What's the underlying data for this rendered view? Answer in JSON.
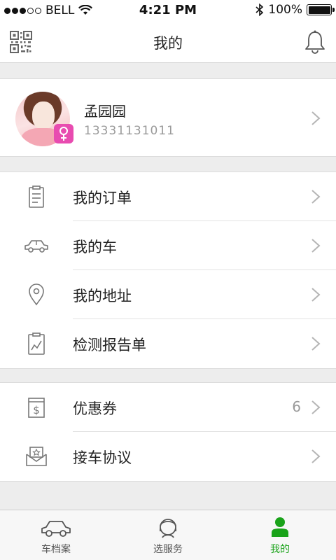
{
  "status_bar": {
    "carrier": "BELL",
    "time": "4:21 PM",
    "battery": "100%"
  },
  "header": {
    "title": "我的",
    "left_icon": "qr-code-icon",
    "right_icon": "bell-icon"
  },
  "profile": {
    "name": "孟园园",
    "phone": "13331131011",
    "gender_icon": "female-icon",
    "badge_color": "#e84bb0"
  },
  "menu_group_1": [
    {
      "label": "我的订单",
      "icon": "clipboard-icon"
    },
    {
      "label": "我的车",
      "icon": "car-icon"
    },
    {
      "label": "我的地址",
      "icon": "location-pin-icon"
    },
    {
      "label": "检测报告单",
      "icon": "report-chart-icon"
    }
  ],
  "menu_group_2": [
    {
      "label": "优惠券",
      "icon": "coupon-dollar-icon",
      "count": "6"
    },
    {
      "label": "接车协议",
      "icon": "agreement-box-icon"
    }
  ],
  "tab_bar": {
    "tabs": [
      {
        "label": "车档案",
        "icon": "car-icon"
      },
      {
        "label": "选服务",
        "icon": "service-person-icon"
      },
      {
        "label": "我的",
        "icon": "user-icon",
        "active": true
      }
    ],
    "active_color": "#1aa31a"
  }
}
